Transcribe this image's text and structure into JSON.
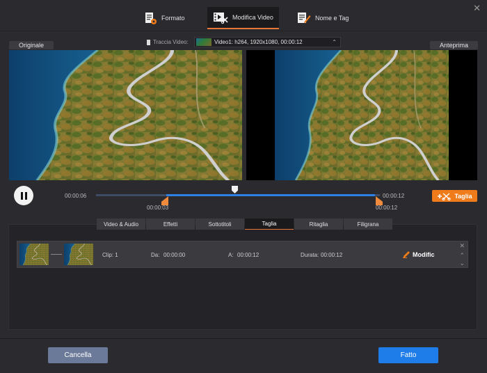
{
  "main_tabs": [
    {
      "label": "Formato",
      "icon": "format-icon"
    },
    {
      "label": "Modifica Video",
      "icon": "edit-video-icon",
      "active": true
    },
    {
      "label": "Nome e Tag",
      "icon": "name-tag-icon"
    }
  ],
  "labels": {
    "original": "Originale",
    "preview": "Anteprima"
  },
  "track": {
    "label": "Traccia Video:",
    "value": "Video1: h264, 1920x1080, 00:00:12"
  },
  "timeline": {
    "start_time": "00:00:06",
    "end_time": "00:00:12",
    "sel_start": "00:00:03",
    "sel_end": "00:00:12",
    "playhead_fraction": 0.48,
    "sel_start_fraction": 0.25,
    "sel_end_fraction": 1.0
  },
  "taglia_label": "Taglia",
  "sub_tabs": [
    "Video & Audio",
    "Effetti",
    "Sottotitoli",
    "Taglia",
    "Ritaglia",
    "Filigrana"
  ],
  "active_sub_tab": "Taglia",
  "clip": {
    "clip_label": "Clip: 1",
    "from_label": "Da:",
    "from_value": "00:00:00",
    "to_label": "A:",
    "to_value": "00:00:12",
    "duration_label": "Durata:",
    "duration_value": "00:00:12",
    "edit_label": "Modific"
  },
  "footer": {
    "cancel": "Cancella",
    "done": "Fatto"
  },
  "colors": {
    "accent": "#f07b1a",
    "primary": "#1e7de8",
    "cancel": "#6b7a99",
    "timeline_sel": "#2e7fe6"
  }
}
